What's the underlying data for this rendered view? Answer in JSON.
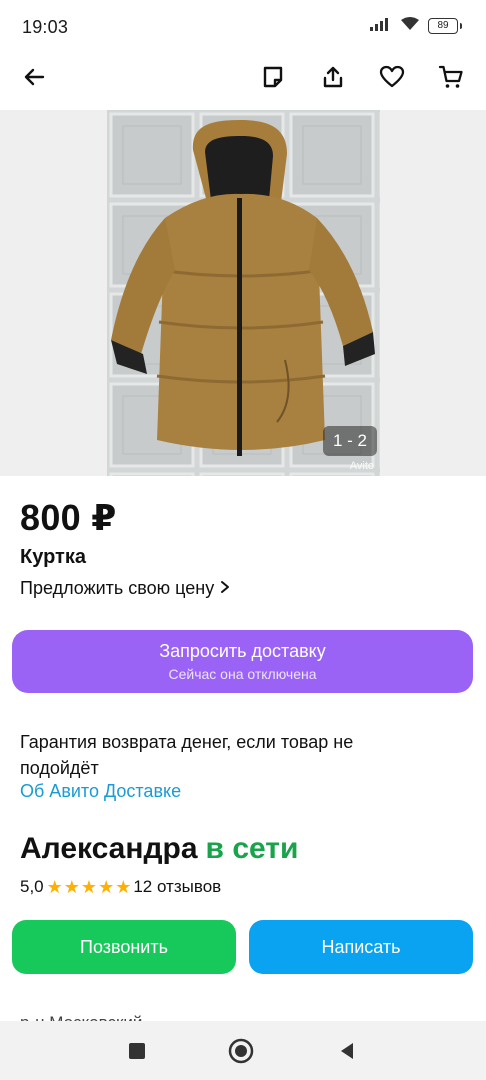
{
  "status_bar": {
    "time": "19:03",
    "battery": "89",
    "icons": [
      "signal-icon",
      "wifi-icon",
      "battery-icon"
    ]
  },
  "app_bar": {
    "icons": [
      "back-arrow-icon",
      "note-icon",
      "share-icon",
      "favorite-heart-icon",
      "cart-icon"
    ]
  },
  "photo": {
    "counter": "1 - 2",
    "watermark": "Avito"
  },
  "listing": {
    "price": "800 ₽",
    "title": "Куртка",
    "offer_price_label": "Предложить свою цену"
  },
  "delivery_button": {
    "label": "Запросить доставку",
    "sublabel": "Сейчас она отключена"
  },
  "guarantee": {
    "text": "Гарантия возврата денег, если товар не подойдёт",
    "link": "Об Авито Доставке"
  },
  "seller": {
    "name": "Александра",
    "status": "в сети",
    "rating_value": "5,0",
    "stars": 5,
    "reviews": "12 отзывов"
  },
  "actions": {
    "call": "Позвонить",
    "write": "Написать"
  },
  "address": {
    "partial": "р-н Московский"
  },
  "colors": {
    "delivery_button": "#9b63f5",
    "call_button": "#17c95a",
    "write_button": "#0aa3f2",
    "online_status": "#19a34a",
    "link": "#1a9bd6",
    "star": "#ffb000"
  },
  "nav_bar": {
    "icons": [
      "recents-square-icon",
      "home-circle-icon",
      "back-triangle-icon"
    ]
  }
}
